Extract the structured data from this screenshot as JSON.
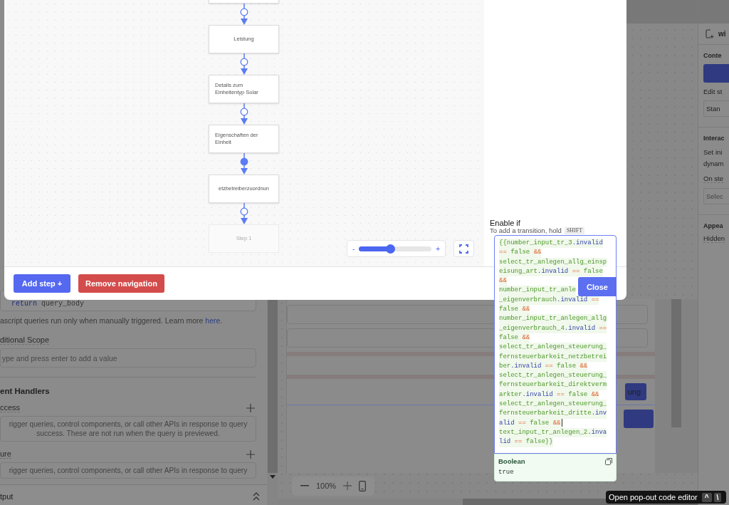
{
  "query_panel": {
    "code_keyword": "return",
    "code_text": "query_body",
    "note": "ascript queries run only when manually triggered. Learn more ",
    "note_link": "here",
    "note_end": ".",
    "scope_label": "ditional Scope",
    "scope_placeholder": "ype and press enter to add a value",
    "handlers_title": "ent Handlers",
    "handlers": [
      {
        "label": "ccess",
        "description": "rigger queries, control components, or call other APIs in response to query success. These are not run when the query is previewed."
      },
      {
        "label": "ure",
        "description": "rigger queries, control components, or call other APIs in response to query"
      }
    ],
    "output_label": "tput"
  },
  "canvas": {
    "partial_button": "ung",
    "zoom_value": "100%"
  },
  "inspector": {
    "title": "wi",
    "content_label": "Conte",
    "edit_label": "Edit st",
    "edit_value": "Stan",
    "interaction_label": "Interac",
    "interaction_text": "Set ini dynam",
    "on_step_label": "On ste",
    "on_step_placeholder": "Selec",
    "appearance_label": "Appea",
    "hidden_label": "Hidden"
  },
  "modal": {
    "steps": [
      {
        "kind": "partial"
      },
      {
        "kind": "step",
        "label": "Leistung"
      },
      {
        "kind": "step",
        "label": "Details zum Einheitentyp Solar"
      },
      {
        "kind": "step",
        "label": "Eigenschaften der Einheit"
      },
      {
        "kind": "step",
        "label": "etzbetreiberzuordnun"
      },
      {
        "kind": "placeholder",
        "label": "Step 1"
      }
    ],
    "transitions": [
      {
        "selected": false
      },
      {
        "selected": false
      },
      {
        "selected": false
      },
      {
        "selected": true
      },
      {
        "selected": false
      }
    ],
    "zoom": {
      "minus": "-",
      "plus": "+",
      "level": 0.43
    },
    "enable_label": "Enable if",
    "hint": "To add a transition, hold",
    "hint_key": "SHIFT",
    "code_lines": [
      {
        "cursor": false,
        "tokens": [
          {
            "text": "{{number_input_tr_3",
            "kind": "var"
          },
          {
            "text": ".invalid",
            "kind": "prop"
          }
        ]
      },
      {
        "cursor": false,
        "tokens": [
          {
            "text": "==",
            "kind": "op"
          },
          {
            "text": " false ",
            "kind": "var"
          },
          {
            "text": "&&",
            "kind": "op"
          }
        ]
      },
      {
        "cursor": false,
        "tokens": [
          {
            "text": "select_tr_anlegen_allg_einsp",
            "kind": "var"
          }
        ]
      },
      {
        "cursor": false,
        "tokens": [
          {
            "text": "eisung_art",
            "kind": "var"
          },
          {
            "text": ".invalid",
            "kind": "prop"
          },
          {
            "text": " ==",
            "kind": "op"
          },
          {
            "text": " false",
            "kind": "var"
          }
        ]
      },
      {
        "cursor": false,
        "tokens": [
          {
            "text": "&&",
            "kind": "op"
          }
        ]
      },
      {
        "cursor": false,
        "tokens": [
          {
            "text": "number_input_tr_anle",
            "kind": "var"
          }
        ]
      },
      {
        "cursor": false,
        "tokens": [
          {
            "text": "_eigenverbrauch",
            "kind": "var"
          },
          {
            "text": ".invalid",
            "kind": "prop"
          },
          {
            "text": " ==",
            "kind": "op"
          }
        ]
      },
      {
        "cursor": false,
        "tokens": [
          {
            "text": "false ",
            "kind": "var"
          },
          {
            "text": "&&",
            "kind": "op"
          }
        ]
      },
      {
        "cursor": false,
        "tokens": [
          {
            "text": "number_input_tr_anlegen_allg",
            "kind": "var"
          }
        ]
      },
      {
        "cursor": false,
        "tokens": [
          {
            "text": "_eigenverbrauch_4",
            "kind": "var"
          },
          {
            "text": ".invalid",
            "kind": "prop"
          },
          {
            "text": " ==",
            "kind": "op"
          }
        ]
      },
      {
        "cursor": false,
        "tokens": [
          {
            "text": "false ",
            "kind": "var"
          },
          {
            "text": "&&",
            "kind": "op"
          }
        ]
      },
      {
        "cursor": false,
        "tokens": [
          {
            "text": "select_tr_anlegen_steuerung_",
            "kind": "var"
          }
        ]
      },
      {
        "cursor": false,
        "tokens": [
          {
            "text": "fernsteuerbarkeit_netzbetrei",
            "kind": "var"
          }
        ]
      },
      {
        "cursor": false,
        "tokens": [
          {
            "text": "ber",
            "kind": "var"
          },
          {
            "text": ".invalid",
            "kind": "prop"
          },
          {
            "text": " ==",
            "kind": "op"
          },
          {
            "text": " false ",
            "kind": "var"
          },
          {
            "text": "&&",
            "kind": "op"
          }
        ]
      },
      {
        "cursor": false,
        "tokens": [
          {
            "text": "select_tr_anlegen_steuerung_",
            "kind": "var"
          }
        ]
      },
      {
        "cursor": false,
        "tokens": [
          {
            "text": "fernsteuerbarkeit_direktverm",
            "kind": "var"
          }
        ]
      },
      {
        "cursor": false,
        "tokens": [
          {
            "text": "arkter",
            "kind": "var"
          },
          {
            "text": ".invalid",
            "kind": "prop"
          },
          {
            "text": " ==",
            "kind": "op"
          },
          {
            "text": " false ",
            "kind": "var"
          },
          {
            "text": "&&",
            "kind": "op"
          }
        ]
      },
      {
        "cursor": false,
        "tokens": [
          {
            "text": "select_tr_anlegen_steuerung_",
            "kind": "var"
          }
        ]
      },
      {
        "cursor": false,
        "tokens": [
          {
            "text": "fernsteuerbarkeit_dritte",
            "kind": "var"
          },
          {
            "text": ".inv",
            "kind": "prop"
          }
        ]
      },
      {
        "cursor": true,
        "tokens": [
          {
            "text": "alid",
            "kind": "prop"
          },
          {
            "text": " ==",
            "kind": "op"
          },
          {
            "text": " false ",
            "kind": "var"
          },
          {
            "text": "&&",
            "kind": "op"
          }
        ]
      },
      {
        "cursor": false,
        "tokens": [
          {
            "text": "text_input_tr_anlegen_2",
            "kind": "var"
          },
          {
            "text": ".inva",
            "kind": "prop"
          }
        ]
      },
      {
        "cursor": false,
        "tokens": [
          {
            "text": "lid",
            "kind": "prop"
          },
          {
            "text": " ==",
            "kind": "op"
          },
          {
            "text": " false}}",
            "kind": "var"
          }
        ]
      }
    ],
    "result_type": "Boolean",
    "result_value": "true",
    "close_label": "Close",
    "add_step_label": "Add step +",
    "remove_label": "Remove navigation"
  },
  "tooltip": {
    "text": "Open pop-out code editor",
    "keys": [
      "^",
      "\\"
    ]
  }
}
